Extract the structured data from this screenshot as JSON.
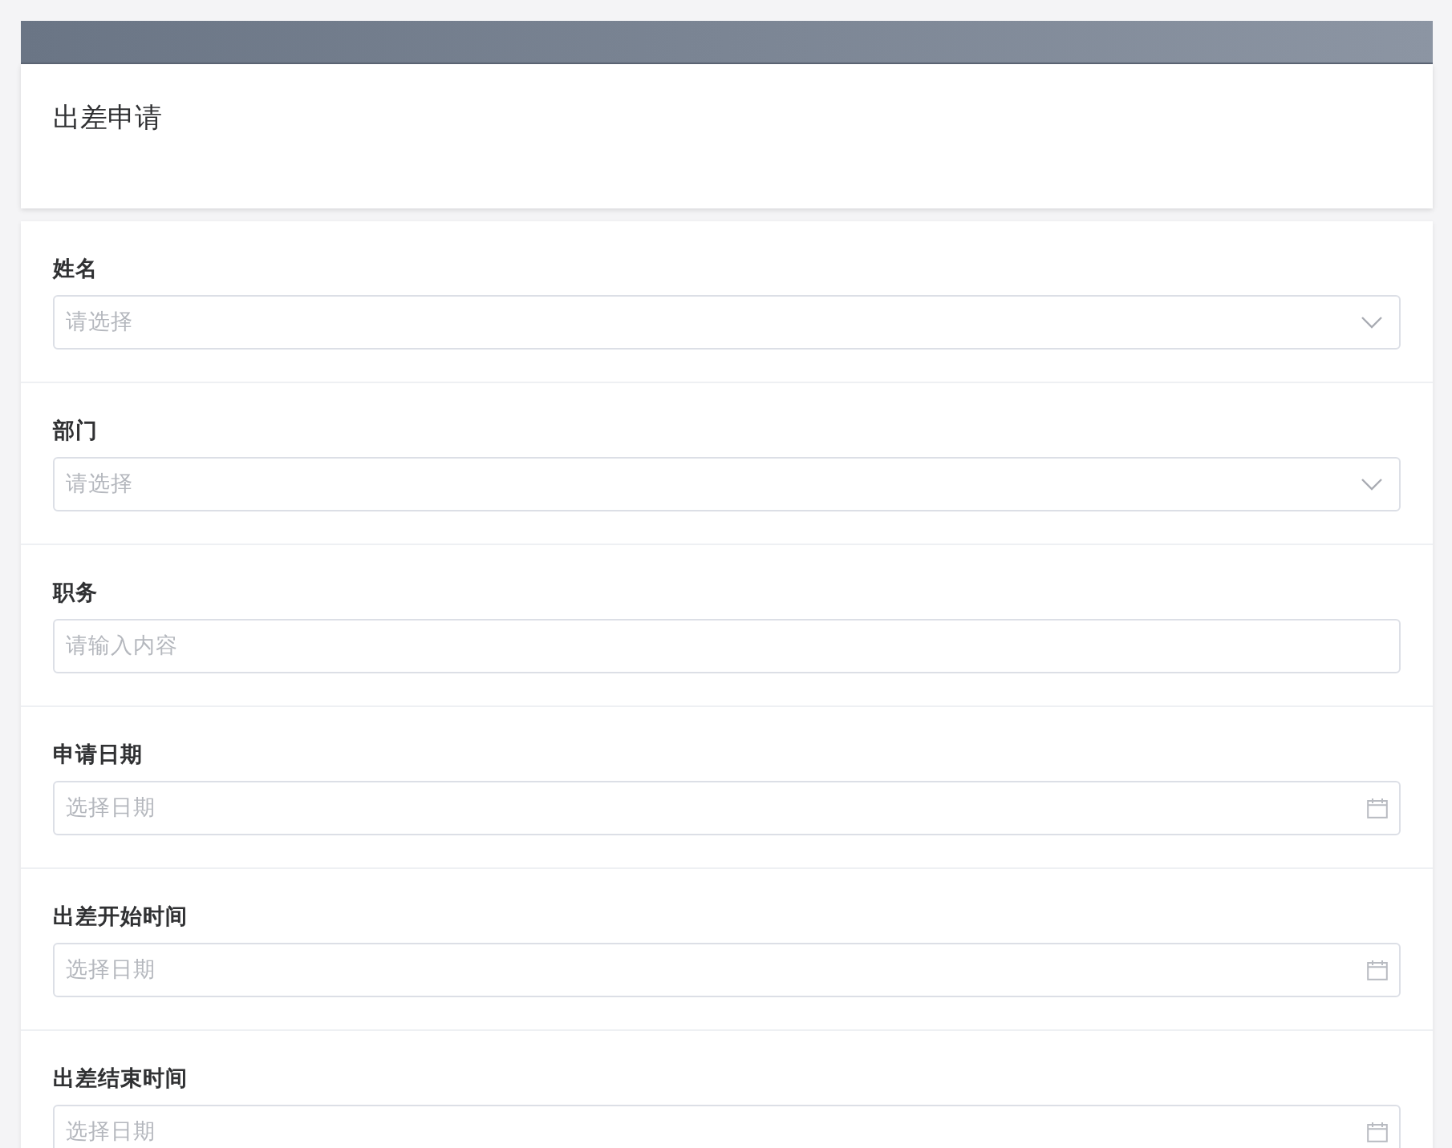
{
  "title": "出差申请",
  "fields": [
    {
      "label": "姓名",
      "kind": "select",
      "placeholder": "请选择"
    },
    {
      "label": "部门",
      "kind": "select",
      "placeholder": "请选择"
    },
    {
      "label": "职务",
      "kind": "text",
      "placeholder": "请输入内容"
    },
    {
      "label": "申请日期",
      "kind": "date",
      "placeholder": "选择日期"
    },
    {
      "label": "出差开始时间",
      "kind": "date",
      "placeholder": "选择日期"
    },
    {
      "label": "出差结束时间",
      "kind": "date",
      "placeholder": "选择日期"
    }
  ]
}
